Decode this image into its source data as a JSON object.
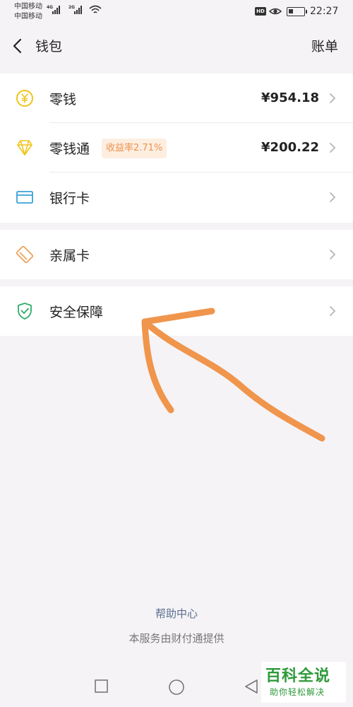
{
  "status_bar": {
    "carrier_1": "中国移动",
    "carrier_2": "中国移动",
    "network_1": "4G",
    "network_2": "2G",
    "hd_label": "HD",
    "time": "22:27"
  },
  "header": {
    "title": "钱包",
    "bill_label": "账单"
  },
  "wallet_items": [
    {
      "label": "零钱",
      "amount": "¥954.18",
      "icon": "yuan-coin-icon",
      "color": "#f0c419"
    },
    {
      "label": "零钱通",
      "amount": "¥200.22",
      "badge": "收益率2.71%",
      "icon": "diamond-icon",
      "color": "#f0c419"
    },
    {
      "label": "银行卡",
      "icon": "bank-card-icon",
      "color": "#3aa0d8"
    },
    {
      "label": "亲属卡",
      "icon": "family-card-icon",
      "color": "#eba25c"
    },
    {
      "label": "安全保障",
      "icon": "shield-check-icon",
      "color": "#2fae6a"
    }
  ],
  "footer": {
    "help_label": "帮助中心",
    "service_note": "本服务由财付通提供"
  },
  "watermark": {
    "title": "百科全说",
    "subtitle": "助你轻松解决"
  },
  "colors": {
    "background": "#f5f3f6",
    "card": "#ffffff",
    "arrow": "#f0954c",
    "badge_bg": "#fdeee0",
    "badge_text": "#ec9350",
    "help_link": "#5b6f8f",
    "watermark": "#2f9a3a"
  }
}
